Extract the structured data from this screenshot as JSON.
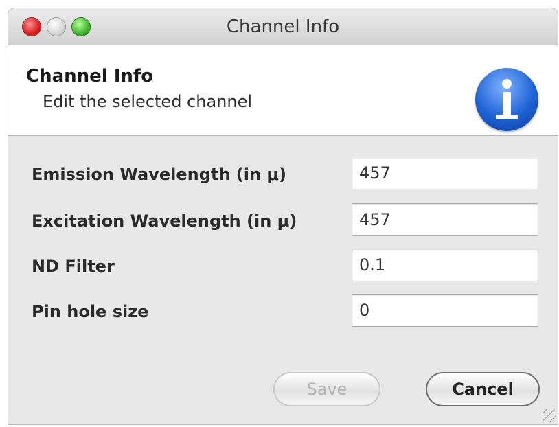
{
  "window": {
    "title": "Channel Info"
  },
  "header": {
    "title": "Channel Info",
    "subtitle": "Edit the selected channel"
  },
  "form": {
    "fields": [
      {
        "label": "Emission Wavelength (in μ)",
        "value": "457"
      },
      {
        "label": "Excitation Wavelength (in μ)",
        "value": "457"
      },
      {
        "label": "ND Filter",
        "value": "0.1"
      },
      {
        "label": "Pin hole size",
        "value": "0"
      }
    ]
  },
  "buttons": {
    "save_label": "Save",
    "cancel_label": "Cancel"
  },
  "colors": {
    "close": "#d81f1f",
    "minimize": "#bdbdbd",
    "maximize": "#3fb52a",
    "info_icon": "#1e62d6"
  }
}
